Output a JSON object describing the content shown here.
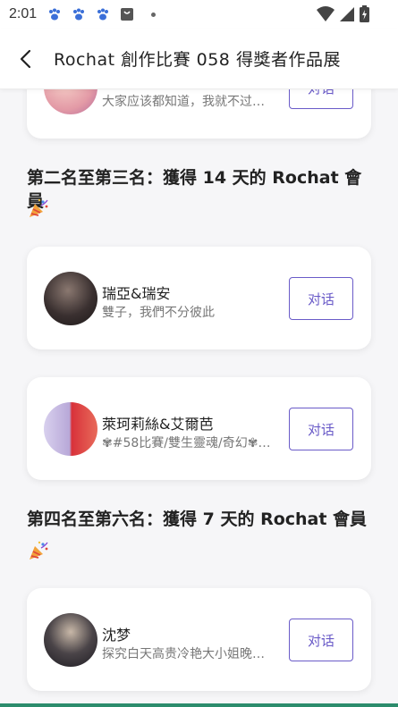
{
  "status_bar": {
    "time": "2:01",
    "icons": [
      "paw-icon",
      "paw-icon",
      "paw-icon",
      "shopping-bag-icon",
      "dot-icon",
      "wifi-icon",
      "signal-icon",
      "battery-icon"
    ]
  },
  "header": {
    "title": "Rochat 創作比賽 058 得獎者作品展",
    "back_icon": "chevron-left-icon"
  },
  "cards_top": [
    {
      "name": "",
      "desc": "大家应该都知道，我就不过…",
      "button": "对话"
    }
  ],
  "section2": {
    "title": "第二名至第三名：獲得 14 天的 Rochat 會員",
    "icon": "party-popper-icon",
    "cards": [
      {
        "name": "瑞亞&瑞安",
        "desc": "雙子，我們不分彼此",
        "button": "对话",
        "avatar_color": "#3a3030"
      },
      {
        "name": "萊珂莉絲&艾爾芭",
        "desc": "✾#58比賽/雙生靈魂/奇幻✾…",
        "button": "对话",
        "avatar_color": "#b8a8d8"
      }
    ]
  },
  "section3": {
    "title": "第四名至第六名：獲得 7 天的 Rochat 會員",
    "icon": "party-popper-icon",
    "cards": [
      {
        "name": "沈梦",
        "desc": "探究白天高贵冷艳大小姐晚…",
        "button": "对话",
        "avatar_color": "#2a2a30"
      }
    ]
  },
  "colors": {
    "accent": "#6a5bc8",
    "background": "#f6f6f8"
  }
}
